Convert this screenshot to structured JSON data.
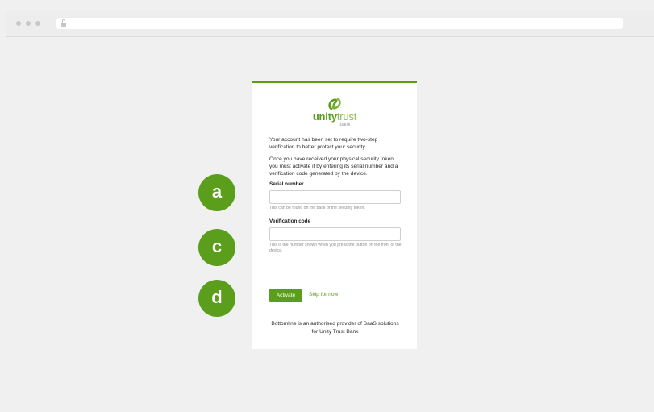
{
  "browser": {
    "url": ""
  },
  "logo": {
    "unity": "unity",
    "trust": "trust",
    "bank": "bank",
    "brand_color": "#5a9e1b"
  },
  "intro": {
    "line1": "Your account has been set to require two-step verification to better protect your security.",
    "line2": "Once you have received your physical security token, you must activate it by entering its serial number and a verification code generated by the device."
  },
  "serial": {
    "label": "Serial number",
    "value": "",
    "help": "This can be found on the back of the security token."
  },
  "verification": {
    "label": "Verification code",
    "value": "",
    "help": "This is the number shown when you press the button on the front of the device."
  },
  "actions": {
    "activate_label": "Activate",
    "skip_label": "Skip for now"
  },
  "footer": {
    "text": "Bottomline is an authorised provider of SaaS solutions for Unity Trust Bank"
  },
  "badges": {
    "a": "a",
    "c": "c",
    "d": "d"
  }
}
